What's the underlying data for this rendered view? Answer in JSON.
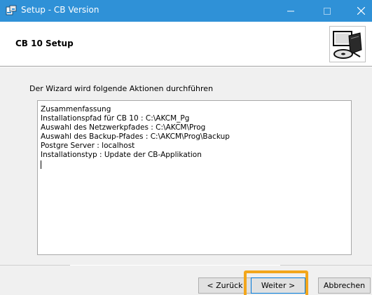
{
  "window": {
    "title": "Setup - CB Version",
    "app_icon": "installer-icon",
    "controls": {
      "minimize": "minimize-icon",
      "maximize": "maximize-icon",
      "close": "close-icon"
    }
  },
  "header": {
    "title": "CB 10 Setup",
    "logo": "setup-computer-logo"
  },
  "body": {
    "description": "Der Wizard wird folgende Aktionen durchführen",
    "summary_lines": [
      "Zusammenfassung",
      "Installationspfad für CB 10 : C:\\AKCM_Pg",
      "Auswahl des Netzwerkpfades : C:\\AKCM\\Prog",
      "Auswahl des Backup-Pfades : C:\\AKCM\\Prog\\Backup",
      "Postgre Server : localhost",
      "Installationstyp :  Update der CB-Applikation"
    ]
  },
  "buttons": {
    "back": "< Zurück",
    "next": "Weiter >",
    "cancel": "Abbrechen"
  },
  "colors": {
    "titlebar": "#2f91d7",
    "highlight": "#f2a61c",
    "focus_border": "#0078d7"
  }
}
